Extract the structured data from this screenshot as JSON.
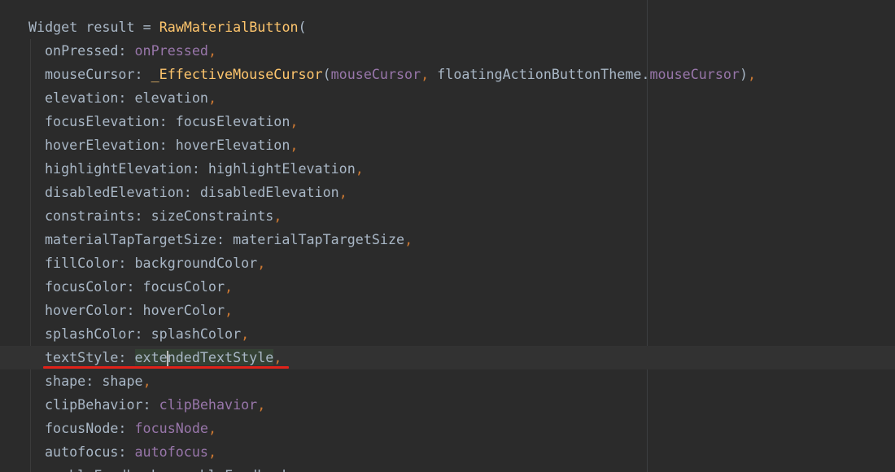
{
  "editor": {
    "lines": [
      {
        "indent": 0,
        "tokens": [
          {
            "text": "Widget result = ",
            "kind": "plain"
          },
          {
            "text": "RawMaterialButton",
            "kind": "class"
          },
          {
            "text": "(",
            "kind": "paren"
          }
        ]
      },
      {
        "indent": 1,
        "tokens": [
          {
            "text": "onPressed: ",
            "kind": "plain"
          },
          {
            "text": "onPressed",
            "kind": "field"
          },
          {
            "text": ",",
            "kind": "comma"
          }
        ]
      },
      {
        "indent": 1,
        "tokens": [
          {
            "text": "mouseCursor: ",
            "kind": "plain"
          },
          {
            "text": "_EffectiveMouseCursor",
            "kind": "class"
          },
          {
            "text": "(",
            "kind": "paren"
          },
          {
            "text": "mouseCursor",
            "kind": "field"
          },
          {
            "text": ", ",
            "kind": "comma"
          },
          {
            "text": "floatingActionButtonTheme",
            "kind": "plain"
          },
          {
            "text": ".",
            "kind": "dot"
          },
          {
            "text": "mouseCursor",
            "kind": "field"
          },
          {
            "text": ")",
            "kind": "paren"
          },
          {
            "text": ",",
            "kind": "comma"
          }
        ]
      },
      {
        "indent": 1,
        "tokens": [
          {
            "text": "elevation: elevation",
            "kind": "plain"
          },
          {
            "text": ",",
            "kind": "comma"
          }
        ]
      },
      {
        "indent": 1,
        "tokens": [
          {
            "text": "focusElevation: focusElevation",
            "kind": "plain"
          },
          {
            "text": ",",
            "kind": "comma"
          }
        ]
      },
      {
        "indent": 1,
        "tokens": [
          {
            "text": "hoverElevation: hoverElevation",
            "kind": "plain"
          },
          {
            "text": ",",
            "kind": "comma"
          }
        ]
      },
      {
        "indent": 1,
        "tokens": [
          {
            "text": "highlightElevation: highlightElevation",
            "kind": "plain"
          },
          {
            "text": ",",
            "kind": "comma"
          }
        ]
      },
      {
        "indent": 1,
        "tokens": [
          {
            "text": "disabledElevation: disabledElevation",
            "kind": "plain"
          },
          {
            "text": ",",
            "kind": "comma"
          }
        ]
      },
      {
        "indent": 1,
        "tokens": [
          {
            "text": "constraints: sizeConstraints",
            "kind": "plain"
          },
          {
            "text": ",",
            "kind": "comma"
          }
        ]
      },
      {
        "indent": 1,
        "tokens": [
          {
            "text": "materialTapTargetSize: materialTapTargetSize",
            "kind": "plain"
          },
          {
            "text": ",",
            "kind": "comma"
          }
        ]
      },
      {
        "indent": 1,
        "tokens": [
          {
            "text": "fillColor: backgroundColor",
            "kind": "plain"
          },
          {
            "text": ",",
            "kind": "comma"
          }
        ]
      },
      {
        "indent": 1,
        "tokens": [
          {
            "text": "focusColor: focusColor",
            "kind": "plain"
          },
          {
            "text": ",",
            "kind": "comma"
          }
        ]
      },
      {
        "indent": 1,
        "tokens": [
          {
            "text": "hoverColor: hoverColor",
            "kind": "plain"
          },
          {
            "text": ",",
            "kind": "comma"
          }
        ]
      },
      {
        "indent": 1,
        "tokens": [
          {
            "text": "splashColor: splashColor",
            "kind": "plain"
          },
          {
            "text": ",",
            "kind": "comma"
          }
        ]
      },
      {
        "indent": 1,
        "caret_line": true,
        "tokens": [
          {
            "text": "textStyle: ",
            "kind": "plain"
          },
          {
            "text": "exte",
            "kind": "plain",
            "highlight": true
          },
          {
            "text": "",
            "kind": "caret"
          },
          {
            "text": "ndedTextStyle",
            "kind": "plain",
            "highlight": true
          },
          {
            "text": ",",
            "kind": "comma"
          }
        ]
      },
      {
        "indent": 1,
        "tokens": [
          {
            "text": "shape: shape",
            "kind": "plain"
          },
          {
            "text": ",",
            "kind": "comma"
          }
        ]
      },
      {
        "indent": 1,
        "tokens": [
          {
            "text": "clipBehavior: ",
            "kind": "plain"
          },
          {
            "text": "clipBehavior",
            "kind": "field"
          },
          {
            "text": ",",
            "kind": "comma"
          }
        ]
      },
      {
        "indent": 1,
        "tokens": [
          {
            "text": "focusNode: ",
            "kind": "plain"
          },
          {
            "text": "focusNode",
            "kind": "field"
          },
          {
            "text": ",",
            "kind": "comma"
          }
        ]
      },
      {
        "indent": 1,
        "tokens": [
          {
            "text": "autofocus: ",
            "kind": "plain"
          },
          {
            "text": "autofocus",
            "kind": "field"
          },
          {
            "text": ",",
            "kind": "comma"
          }
        ]
      },
      {
        "indent": 1,
        "tokens": [
          {
            "text": "enableFeedback: enableFeedback",
            "kind": "plain"
          },
          {
            "text": ",",
            "kind": "comma"
          }
        ]
      }
    ]
  },
  "annotation": {
    "color": "#e0221a",
    "marked_line": 14
  },
  "colors": {
    "background": "#2b2b2b",
    "plain": "#a9b7c6",
    "class_name": "#ffc66d",
    "punctuation": "#cc7832",
    "field": "#9876aa",
    "reference_highlight": "#344134",
    "caret_line": "#323232"
  }
}
